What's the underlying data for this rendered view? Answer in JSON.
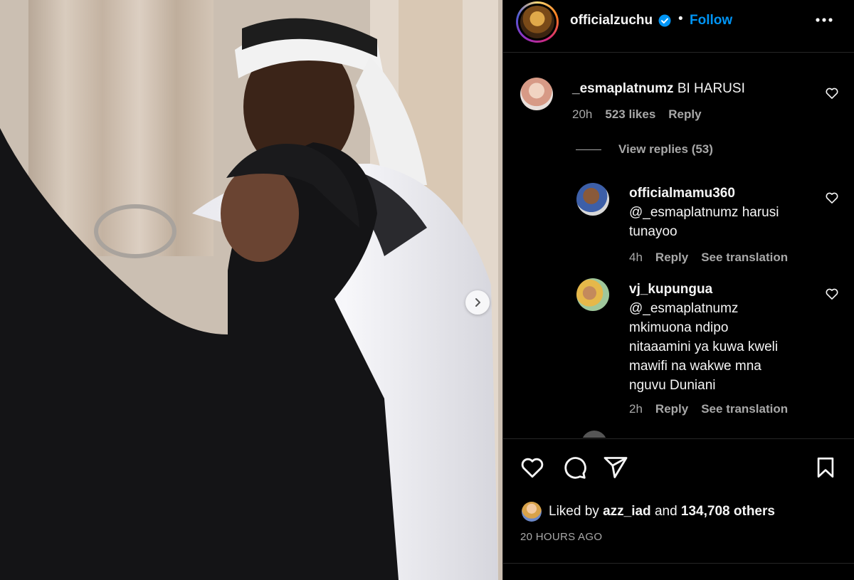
{
  "post": {
    "username": "officialzuchu",
    "dot": "•",
    "follow_label": "Follow"
  },
  "comments": [
    {
      "username": "_esmaplatnumz",
      "text": "BI HARUSI",
      "time": "20h",
      "likes": "523 likes",
      "reply": "Reply",
      "view_replies": "View replies (53)"
    }
  ],
  "replies": [
    {
      "username": "officialmamu360",
      "text_lines": [
        "@_esmaplatnumz harusi",
        "tunayoo"
      ],
      "time": "4h",
      "reply": "Reply",
      "translation": "See translation"
    },
    {
      "username": "vj_kupungua",
      "text_lines": [
        "@_esmaplatnumz",
        "mkimuona ndipo",
        "nitaaamini ya kuwa kweli",
        "mawifi na wakwe mna",
        "nguvu Duniani"
      ],
      "time": "2h",
      "reply": "Reply",
      "translation": "See translation"
    }
  ],
  "engagement": {
    "liked_prefix": "Liked by",
    "liked_user": "azz_iad",
    "liked_and": "and",
    "liked_others": "134,708 others",
    "time_ago": "20 HOURS AGO"
  },
  "icons": {
    "verified": "verified-badge-icon",
    "more": "more-horizontal-icon",
    "heart": "heart-icon",
    "comment": "comment-icon",
    "share": "share-icon",
    "save": "bookmark-icon",
    "next": "chevron-right-icon"
  },
  "colors": {
    "background": "#000000",
    "text": "#f5f5f5",
    "secondary": "#a8a8a8",
    "accent": "#0095f6"
  }
}
